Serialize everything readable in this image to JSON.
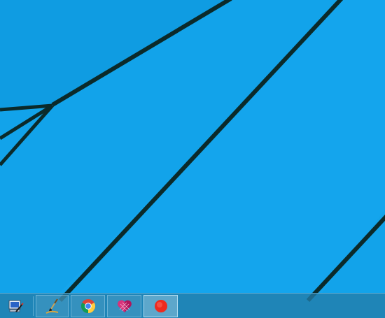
{
  "wallpaper": {
    "background_color": "#12a3ea",
    "line_color": "#0b2a2a"
  },
  "taskbar": {
    "background_color": "#227ca8",
    "items": [
      {
        "icon": "computer-pen-icon",
        "state": "pinned"
      },
      {
        "icon": "paint-brush-icon",
        "state": "open"
      },
      {
        "icon": "chrome-icon",
        "state": "open"
      },
      {
        "icon": "heart-app-icon",
        "state": "open"
      },
      {
        "icon": "record-icon",
        "state": "active",
        "accent": "#ee2a1f"
      }
    ]
  }
}
